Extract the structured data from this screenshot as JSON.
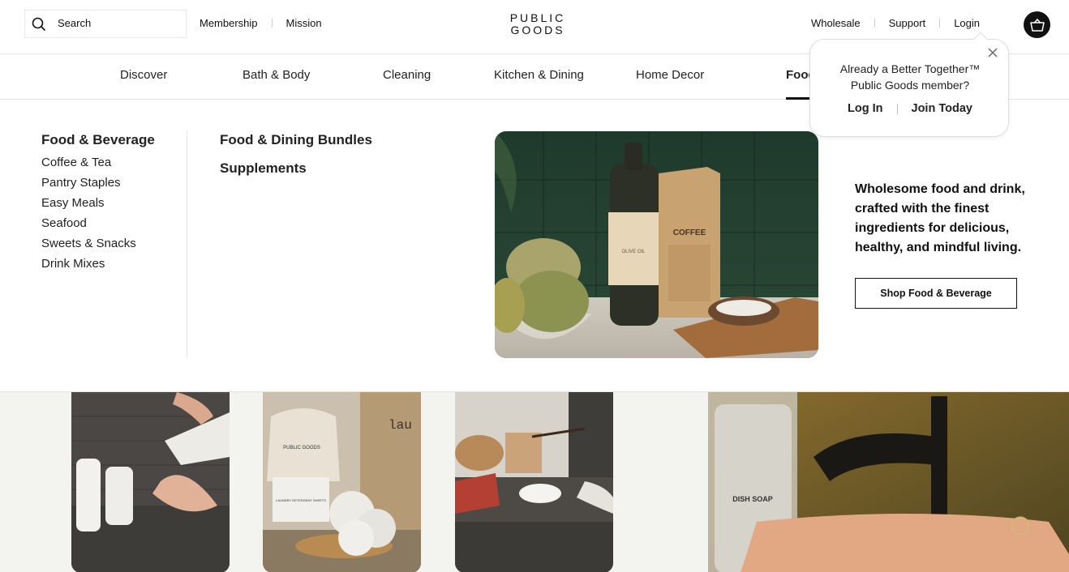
{
  "header": {
    "search_placeholder": "Search",
    "left_links": [
      "Membership",
      "Mission"
    ],
    "logo_line1": "PUBLIC",
    "logo_line2": "GOODS",
    "right_links": [
      "Wholesale",
      "Support",
      "Login"
    ]
  },
  "nav": {
    "items": [
      "Discover",
      "Bath & Body",
      "Cleaning",
      "Kitchen & Dining",
      "Home Decor",
      "Food"
    ],
    "active": "Food"
  },
  "menu": {
    "col1_heading": "Food & Beverage",
    "col1_links": [
      "Coffee & Tea",
      "Pantry Staples",
      "Easy Meals",
      "Seafood",
      "Sweets & Snacks",
      "Drink Mixes"
    ],
    "col2_links": [
      "Food & Dining Bundles",
      "Supplements"
    ],
    "promo_text": "Wholesome food and drink, crafted with the finest ingredients for delicious, healthy, and mindful living.",
    "promo_button": "Shop Food & Beverage",
    "promo_image_labels": {
      "bottle": "OLIVE OIL",
      "bag": "COFFEE"
    }
  },
  "popover": {
    "message_line1": "Already a Better Together™",
    "message_line2": "Public Goods member?",
    "login_label": "Log In",
    "join_label": "Join Today"
  },
  "bottom_tiles": {
    "labels": {
      "laundry_sign": "lau",
      "bag_logo": "PUBLIC GOODS",
      "sheets_box": "LAUNDRY DETERGENT SHEETS",
      "soap": "DISH SOAP"
    }
  },
  "colors": {
    "accent": "#111111",
    "bottom_bg": "#f3f3ef"
  }
}
